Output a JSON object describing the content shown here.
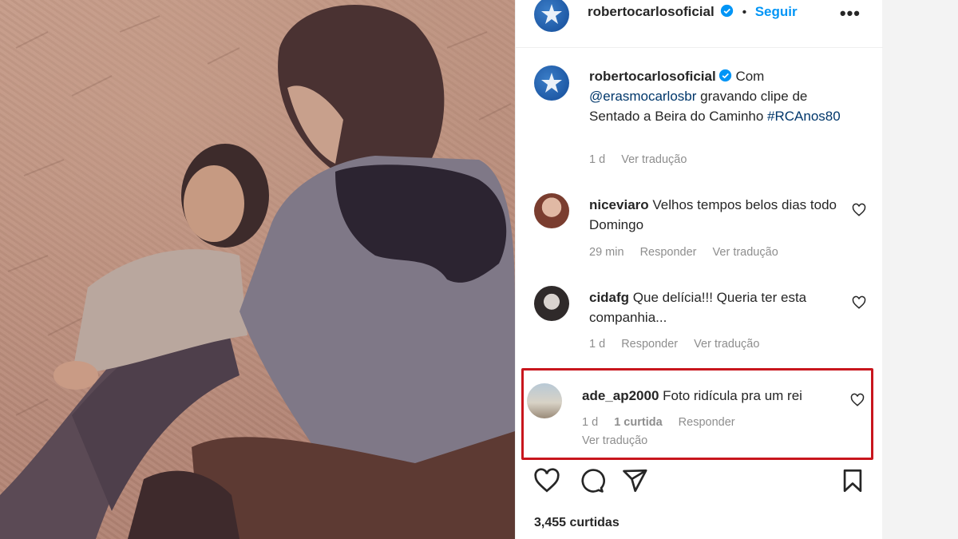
{
  "post": {
    "author": "robertocarlosoficial",
    "follow_label": "Seguir",
    "more_label": "•••",
    "caption_prefix": "Com",
    "caption_mention": "@erasmocarlosbr",
    "caption_text": "gravando clipe de Sentado a Beira do Caminho",
    "caption_hashtag": "#RCAnos80",
    "caption_age": "1 d",
    "translate_label": "Ver tradução",
    "likes_count": "3,455 curtidas"
  },
  "comments": [
    {
      "user": "niceviaro",
      "text": "Velhos tempos belos dias todo Domingo",
      "age": "29 min",
      "reply_label": "Responder",
      "translate_label": "Ver tradução"
    },
    {
      "user": "cidafg",
      "text": "Que delícia!!! Queria ter esta companhia...",
      "age": "1 d",
      "reply_label": "Responder",
      "translate_label": "Ver tradução"
    },
    {
      "user": "ade_ap2000",
      "text": "Foto ridícula pra um rei",
      "age": "1 d",
      "likes": "1 curtida",
      "reply_label": "Responder",
      "translate_label": "Ver tradução"
    }
  ],
  "icons": {
    "like": "heart-icon",
    "comment": "comment-icon",
    "share": "share-icon",
    "save": "bookmark-icon",
    "verified": "verified-icon"
  },
  "colors": {
    "link": "#00376b",
    "follow": "#0095f6",
    "verified": "#0095f6",
    "highlight": "#c8161d"
  }
}
